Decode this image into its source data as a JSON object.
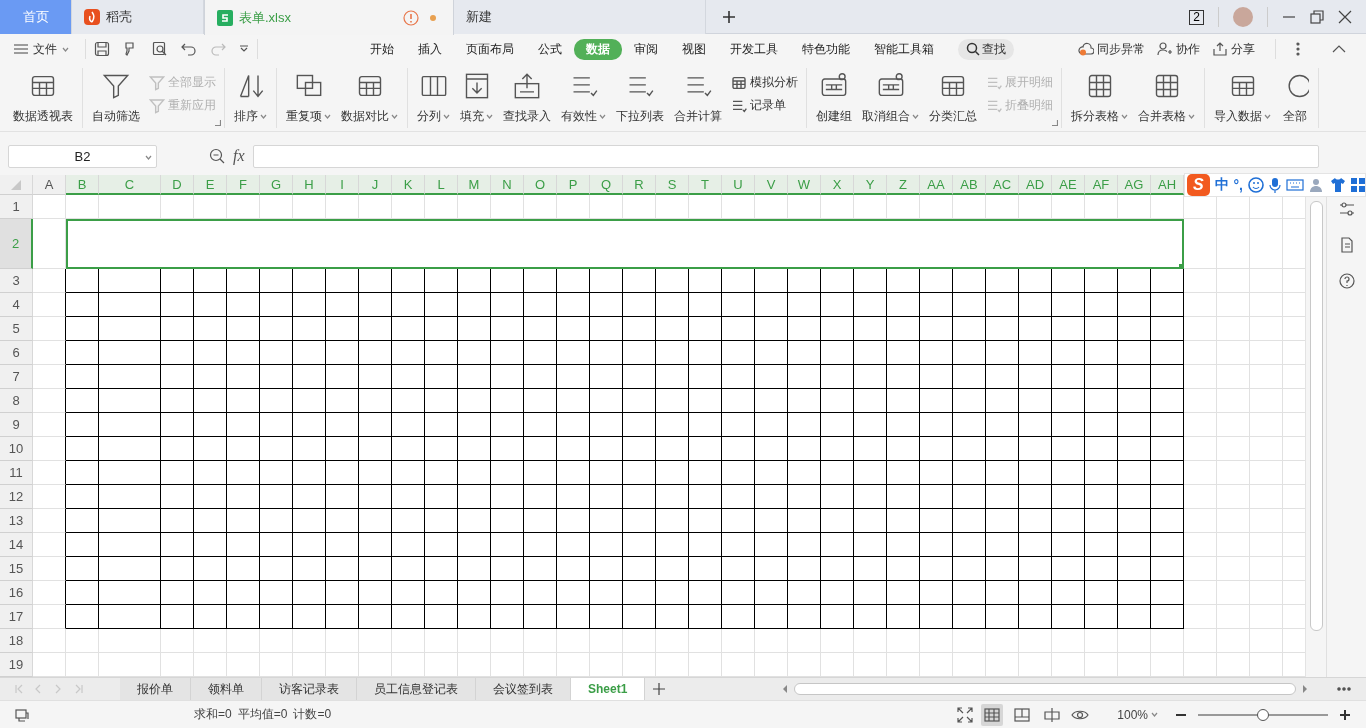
{
  "tabs": [
    {
      "label": "首页",
      "kind": "home",
      "selected": false
    },
    {
      "label": "稻壳",
      "kind": "docer",
      "selected": false
    },
    {
      "label": "表单.xlsx",
      "kind": "sheet",
      "selected": true,
      "warning": true,
      "modified": true
    },
    {
      "label": "新建",
      "kind": "new",
      "selected": false
    }
  ],
  "window_count": "2",
  "menu": {
    "file": "文件",
    "tabs": [
      {
        "label": "开始",
        "selected": false
      },
      {
        "label": "插入",
        "selected": false
      },
      {
        "label": "页面布局",
        "selected": false
      },
      {
        "label": "公式",
        "selected": false
      },
      {
        "label": "数据",
        "selected": true
      },
      {
        "label": "审阅",
        "selected": false
      },
      {
        "label": "视图",
        "selected": false
      },
      {
        "label": "开发工具",
        "selected": false
      },
      {
        "label": "特色功能",
        "selected": false
      },
      {
        "label": "智能工具箱",
        "selected": false
      }
    ],
    "search": "查找",
    "actions": [
      "同步异常",
      "协作",
      "分享"
    ]
  },
  "ribbon": [
    {
      "launcher": false,
      "items": [
        {
          "label": "数据透视表",
          "kind": "large",
          "dropdown": false,
          "disabled": false
        }
      ]
    },
    {
      "launcher": true,
      "items": [
        {
          "label": "自动筛选",
          "kind": "large",
          "dropdown": false,
          "disabled": false
        },
        {
          "label": "全部显示",
          "kind": "small",
          "dropdown": false,
          "disabled": true
        },
        {
          "label": "重新应用",
          "kind": "small",
          "dropdown": false,
          "disabled": true
        }
      ]
    },
    {
      "launcher": false,
      "items": [
        {
          "label": "排序",
          "kind": "large",
          "dropdown": true,
          "disabled": false
        }
      ]
    },
    {
      "launcher": false,
      "items": [
        {
          "label": "重复项",
          "kind": "large",
          "dropdown": true,
          "disabled": false
        },
        {
          "label": "数据对比",
          "kind": "large",
          "dropdown": true,
          "disabled": false
        }
      ]
    },
    {
      "launcher": false,
      "items": [
        {
          "label": "分列",
          "kind": "large",
          "dropdown": true,
          "disabled": false
        },
        {
          "label": "填充",
          "kind": "large",
          "dropdown": true,
          "disabled": false
        },
        {
          "label": "查找录入",
          "kind": "large",
          "dropdown": false,
          "disabled": false
        },
        {
          "label": "有效性",
          "kind": "large",
          "dropdown": true,
          "disabled": false
        },
        {
          "label": "下拉列表",
          "kind": "large",
          "dropdown": false,
          "disabled": false
        },
        {
          "label": "合并计算",
          "kind": "large",
          "dropdown": false,
          "disabled": false
        },
        {
          "label": "模拟分析",
          "kind": "small",
          "dropdown": false,
          "disabled": false
        },
        {
          "label": "记录单",
          "kind": "small",
          "dropdown": false,
          "disabled": false
        }
      ]
    },
    {
      "launcher": true,
      "items": [
        {
          "label": "创建组",
          "kind": "large",
          "dropdown": false,
          "disabled": false
        },
        {
          "label": "取消组合",
          "kind": "large",
          "dropdown": true,
          "disabled": false
        },
        {
          "label": "分类汇总",
          "kind": "large",
          "dropdown": false,
          "disabled": false
        },
        {
          "label": "展开明细",
          "kind": "small",
          "dropdown": false,
          "disabled": true
        },
        {
          "label": "折叠明细",
          "kind": "small",
          "dropdown": false,
          "disabled": true
        }
      ]
    },
    {
      "launcher": false,
      "items": [
        {
          "label": "拆分表格",
          "kind": "large",
          "dropdown": true,
          "disabled": false
        },
        {
          "label": "合并表格",
          "kind": "large",
          "dropdown": true,
          "disabled": false
        }
      ]
    },
    {
      "launcher": false,
      "items": [
        {
          "label": "导入数据",
          "kind": "large",
          "dropdown": true,
          "disabled": false
        },
        {
          "label": "全部",
          "kind": "large",
          "dropdown": false,
          "disabled": false
        }
      ]
    }
  ],
  "name_box": "B2",
  "fx": "fx",
  "ime": {
    "logo": "S",
    "mode": "中",
    "punct": "°,"
  },
  "columns": [
    {
      "label": "A",
      "selected": false
    },
    {
      "label": "B",
      "selected": true
    },
    {
      "label": "C",
      "selected": true
    },
    {
      "label": "D",
      "selected": true
    },
    {
      "label": "E",
      "selected": true
    },
    {
      "label": "F",
      "selected": true
    },
    {
      "label": "G",
      "selected": true
    },
    {
      "label": "H",
      "selected": true
    },
    {
      "label": "I",
      "selected": true
    },
    {
      "label": "J",
      "selected": true
    },
    {
      "label": "K",
      "selected": true
    },
    {
      "label": "L",
      "selected": true
    },
    {
      "label": "M",
      "selected": true
    },
    {
      "label": "N",
      "selected": true
    },
    {
      "label": "O",
      "selected": true
    },
    {
      "label": "P",
      "selected": true
    },
    {
      "label": "Q",
      "selected": true
    },
    {
      "label": "R",
      "selected": true
    },
    {
      "label": "S",
      "selected": true
    },
    {
      "label": "T",
      "selected": true
    },
    {
      "label": "U",
      "selected": true
    },
    {
      "label": "V",
      "selected": true
    },
    {
      "label": "W",
      "selected": true
    },
    {
      "label": "X",
      "selected": true
    },
    {
      "label": "Y",
      "selected": true
    },
    {
      "label": "Z",
      "selected": true
    },
    {
      "label": "AA",
      "selected": true
    },
    {
      "label": "AB",
      "selected": true
    },
    {
      "label": "AC",
      "selected": true
    },
    {
      "label": "AD",
      "selected": true
    },
    {
      "label": "AE",
      "selected": true
    },
    {
      "label": "AF",
      "selected": true
    },
    {
      "label": "AG",
      "selected": true
    },
    {
      "label": "AH",
      "selected": true
    }
  ],
  "rows": [
    {
      "label": "1",
      "selected": false,
      "bordered": false
    },
    {
      "label": "2",
      "selected": true,
      "bordered": false
    },
    {
      "label": "3",
      "selected": false,
      "bordered": true
    },
    {
      "label": "4",
      "selected": false,
      "bordered": true
    },
    {
      "label": "5",
      "selected": false,
      "bordered": true
    },
    {
      "label": "6",
      "selected": false,
      "bordered": true
    },
    {
      "label": "7",
      "selected": false,
      "bordered": true
    },
    {
      "label": "8",
      "selected": false,
      "bordered": true
    },
    {
      "label": "9",
      "selected": false,
      "bordered": true
    },
    {
      "label": "10",
      "selected": false,
      "bordered": true
    },
    {
      "label": "11",
      "selected": false,
      "bordered": true
    },
    {
      "label": "12",
      "selected": false,
      "bordered": true
    },
    {
      "label": "13",
      "selected": false,
      "bordered": true
    },
    {
      "label": "14",
      "selected": false,
      "bordered": true
    },
    {
      "label": "15",
      "selected": false,
      "bordered": true
    },
    {
      "label": "16",
      "selected": false,
      "bordered": true
    },
    {
      "label": "17",
      "selected": false,
      "bordered": true
    },
    {
      "label": "18",
      "selected": false,
      "bordered": false
    },
    {
      "label": "19",
      "selected": false,
      "bordered": false
    }
  ],
  "sheets": [
    {
      "label": "报价单",
      "selected": false
    },
    {
      "label": "领料单",
      "selected": false
    },
    {
      "label": "访客记录表",
      "selected": false
    },
    {
      "label": "员工信息登记表",
      "selected": false
    },
    {
      "label": "会议签到表",
      "selected": false
    },
    {
      "label": "Sheet1",
      "selected": true
    }
  ],
  "status": {
    "sum": "求和=0",
    "average": "平均值=0",
    "count": "计数=0",
    "views": [
      {
        "kind": "normal",
        "selected": true
      },
      {
        "kind": "page",
        "selected": false
      },
      {
        "kind": "break",
        "selected": false
      }
    ],
    "zoom": "100%",
    "level": 0.5
  }
}
